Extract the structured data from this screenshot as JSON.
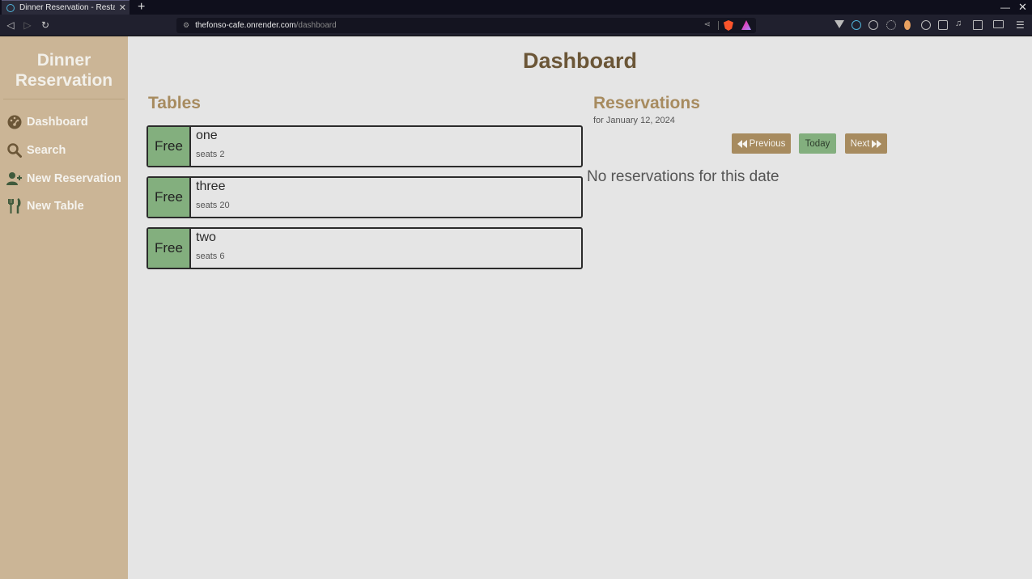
{
  "browser": {
    "tab_title": "Dinner Reservation - Restaurant",
    "url_host": "thefonso-cafe.onrender.com",
    "url_path": "/dashboard"
  },
  "sidebar": {
    "brand_line1": "Dinner",
    "brand_line2": "Reservation",
    "items": [
      {
        "label": "Dashboard",
        "icon": "dashboard-gauge-icon"
      },
      {
        "label": "Search",
        "icon": "search-icon"
      },
      {
        "label": "New Reservation",
        "icon": "user-plus-icon"
      },
      {
        "label": "New Table",
        "icon": "utensils-icon"
      }
    ]
  },
  "main": {
    "title": "Dashboard",
    "tables_heading": "Tables",
    "tables": [
      {
        "status": "Free",
        "name": "one",
        "seats": "seats 2"
      },
      {
        "status": "Free",
        "name": "three",
        "seats": "seats 20"
      },
      {
        "status": "Free",
        "name": "two",
        "seats": "seats 6"
      }
    ],
    "reservations_heading": "Reservations",
    "reservations_date": "for January 12, 2024",
    "prev_label": "Previous",
    "today_label": "Today",
    "next_label": "Next",
    "empty_message": "No reservations for this date"
  },
  "colors": {
    "sidebar_bg": "#cbb596",
    "accent_brown": "#a78b5f",
    "title_brown": "#6b5637",
    "free_green": "#83af7e",
    "page_bg": "#e5e5e5"
  }
}
